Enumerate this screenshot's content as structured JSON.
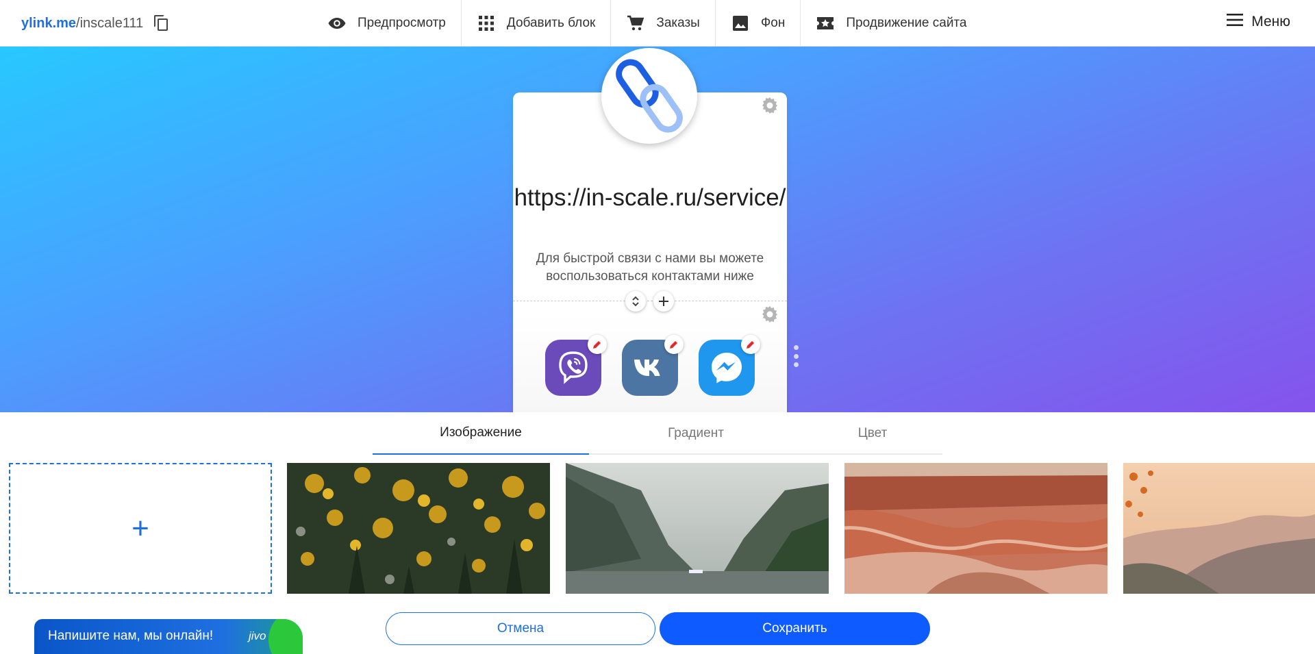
{
  "header": {
    "domain": "ylink.me",
    "slug": "/inscale111",
    "nav": [
      {
        "label": "Предпросмотр",
        "icon": "eye-icon"
      },
      {
        "label": "Добавить блок",
        "icon": "grid-icon"
      },
      {
        "label": "Заказы",
        "icon": "cart-icon"
      },
      {
        "label": "Фон",
        "icon": "image-icon"
      },
      {
        "label": "Продвижение сайта",
        "icon": "ticket-star-icon"
      }
    ],
    "menu_label": "Меню"
  },
  "page": {
    "headline": "https://in-scale.ru/service/",
    "description": "Для быстрой связи с нами вы можете воспользоваться контактами ниже",
    "socials": [
      {
        "name": "viber-icon",
        "color": "#6b4aba"
      },
      {
        "name": "vk-icon",
        "color": "#4d75a3"
      },
      {
        "name": "messenger-icon",
        "color": "#1f97ee"
      }
    ],
    "accent": "#1e6fe0"
  },
  "background_panel": {
    "tabs": [
      "Изображение",
      "Градиент",
      "Цвет"
    ],
    "active_tab": "Изображение",
    "add_label": "+",
    "thumbnails": [
      "forest-autumn",
      "fjord-mountains",
      "red-canyon",
      "autumn-hills"
    ]
  },
  "actions": {
    "cancel": "Отмена",
    "save": "Сохранить"
  },
  "chat_widget": {
    "text": "Напишите нам, мы онлайн!",
    "logo": "jivo"
  }
}
